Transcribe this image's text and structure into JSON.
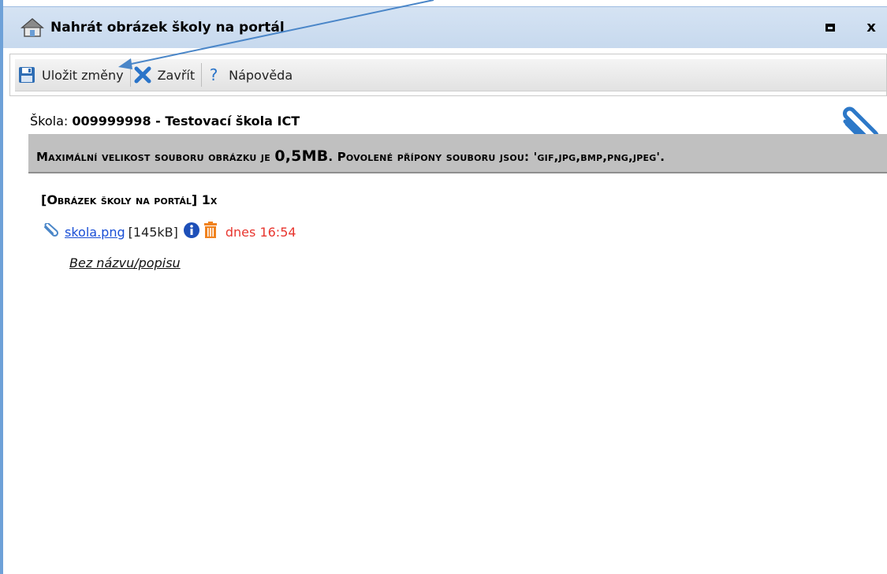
{
  "window": {
    "title": "Nahrát obrázek školy na portál",
    "maximize_icon": "maximize-icon",
    "close_label": "x"
  },
  "toolbar": {
    "save_label": "Uložit změny",
    "close_label": "Zavřít",
    "help_label": "Nápověda"
  },
  "school": {
    "label": "Škola:",
    "value": "009999998 - Testovací škola ICT"
  },
  "notice": {
    "part1": "Maximální velikost souboru obrázku je ",
    "size": "0,5MB",
    "part2": ". Povolené přípony souboru jsou: 'gif,jpg,bmp,png,jpeg'."
  },
  "attachment_section": {
    "title": "[Obrázek školy na portál]",
    "count": "1x"
  },
  "file": {
    "name": "skola.png",
    "size": "[145kB]",
    "date": "dnes 16:54",
    "description": "Bez názvu/popisu"
  },
  "colors": {
    "title_bar": "#c7d9ee",
    "window_border": "#6ea1d8",
    "notice_bg": "#c0c0c0",
    "link": "#1a4fd6",
    "date": "#e8362f",
    "delete_icon": "#f0821e",
    "info_icon": "#1d4fb8",
    "arrow": "#4a86c8"
  }
}
